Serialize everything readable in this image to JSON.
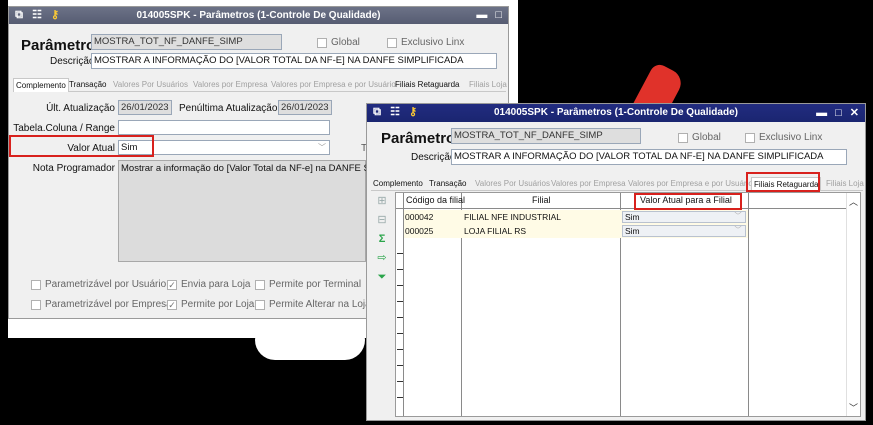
{
  "win1": {
    "title": "014005SPK - Parâmetros (1-Controle De Qualidade)",
    "param_title": "Parâmetro",
    "param_value": "MOSTRA_TOT_NF_DANFE_SIMP",
    "global_label": "Global",
    "exclusivo_label": "Exclusivo Linx",
    "descricao_label": "Descrição",
    "descricao_value": "MOSTRAR A INFORMAÇÃO DO [VALOR TOTAL DA NF-E] NA DANFE SIMPLIFICADA",
    "tabs": [
      "Complemento",
      "Transação",
      "Valores Por Usuários",
      "Valores por Empresa",
      "Valores por Empresa e por Usuário",
      "Filiais Retaguarda",
      "Filiais Loja"
    ],
    "ult_atualizacao_label": "Últ. Atualização",
    "ult_atualizacao_value": "26/01/2023",
    "penultima_label": "Penúltima Atualização",
    "penultima_value": "26/01/2023",
    "tabela_label": "Tabela.Coluna / Range",
    "valor_atual_label": "Valor Atual",
    "valor_atual_value": "Sim",
    "tipo_label": "T",
    "nota_label": "Nota Programador",
    "nota_value": "Mostrar a informação do [Valor Total da NF-e] na DANFE Simplifica",
    "checks": [
      {
        "label": "Parametrizável por Usuário",
        "checked": false
      },
      {
        "label": "Envia para Loja",
        "checked": true
      },
      {
        "label": "Permite por Terminal",
        "checked": false
      },
      {
        "label": "Parametrizável por Empresa",
        "checked": false
      },
      {
        "label": "Permite por Loja",
        "checked": true
      },
      {
        "label": "Permite Alterar na Loja",
        "checked": false
      }
    ]
  },
  "win2": {
    "title": "014005SPK - Parâmetros (1-Controle De Qualidade)",
    "param_title": "Parâmetro",
    "param_value": "MOSTRA_TOT_NF_DANFE_SIMP",
    "global_label": "Global",
    "exclusivo_label": "Exclusivo Linx",
    "descricao_label": "Descrição",
    "descricao_value": "MOSTRAR A INFORMAÇÃO DO [VALOR TOTAL DA NF-E] NA DANFE SIMPLIFICADA",
    "tabs": [
      "Complemento",
      "Transação",
      "Valores Por Usuários",
      "Valores por Empresa",
      "Valores por Empresa e por Usuário",
      "Filiais Retaguarda",
      "Filiais Loja"
    ],
    "grid_headers": [
      "Código da filial",
      "Filial",
      "Valor Atual para a Filial"
    ],
    "rows": [
      {
        "codigo": "000042",
        "filial": "FILIAL NFE INDUSTRIAL",
        "valor": "Sim"
      },
      {
        "codigo": "000025",
        "filial": "LOJA FILIAL RS",
        "valor": "Sim"
      }
    ]
  }
}
